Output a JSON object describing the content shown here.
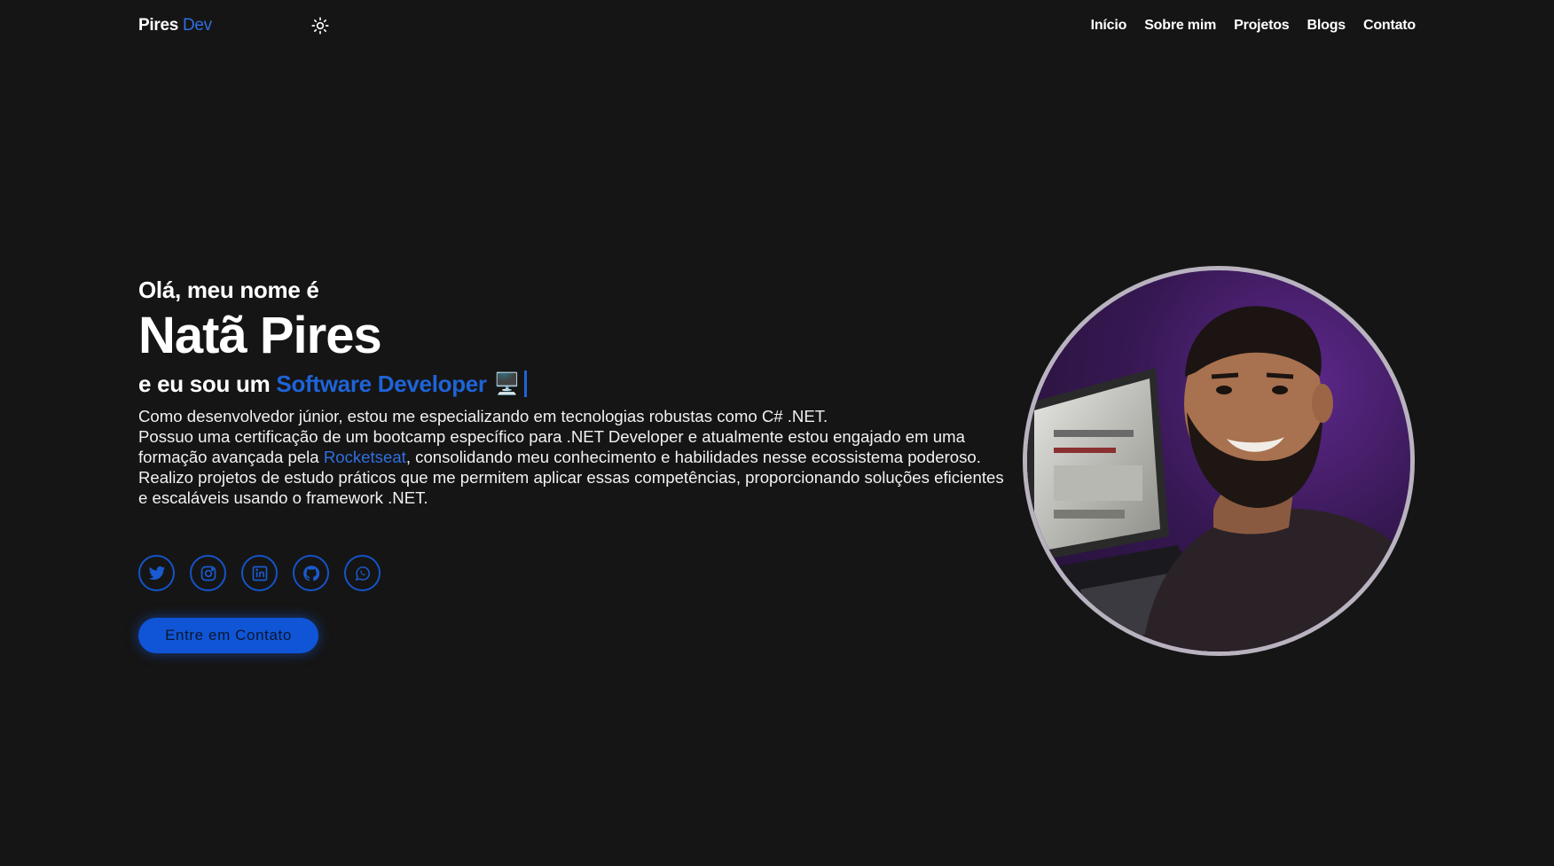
{
  "header": {
    "logo_primary": "Pires",
    "logo_accent": "Dev",
    "theme_icon": "sun-icon",
    "nav": [
      "Início",
      "Sobre mim",
      "Projetos",
      "Blogs",
      "Contato"
    ]
  },
  "hero": {
    "greeting": "Olá, meu nome é",
    "name": "Natã Pires",
    "role_prefix": "e eu sou um",
    "role": "Software Developer",
    "role_emoji": "🖥️",
    "bio_line1": "Como desenvolvedor júnior, estou me especializando em tecnologias robustas como C# .NET.",
    "bio_line2_start": "Possuo uma certificação de um bootcamp específico para .NET Developer e atualmente estou engajado em uma formação avançada pela ",
    "bio_link": "Rocketseat",
    "bio_line2_end": ", consolidando meu conhecimento e habilidades nesse ecossistema poderoso.",
    "bio_line3": "Realizo projetos de estudo práticos que me permitem aplicar essas competências, proporcionando soluções eficientes e escaláveis usando o framework .NET.",
    "socials": [
      "twitter-icon",
      "instagram-icon",
      "linkedin-icon",
      "github-icon",
      "whatsapp-icon"
    ],
    "cta": "Entre em Contato"
  },
  "colors": {
    "background": "#151515",
    "accent": "#1f63d8",
    "text": "#ffffff"
  }
}
